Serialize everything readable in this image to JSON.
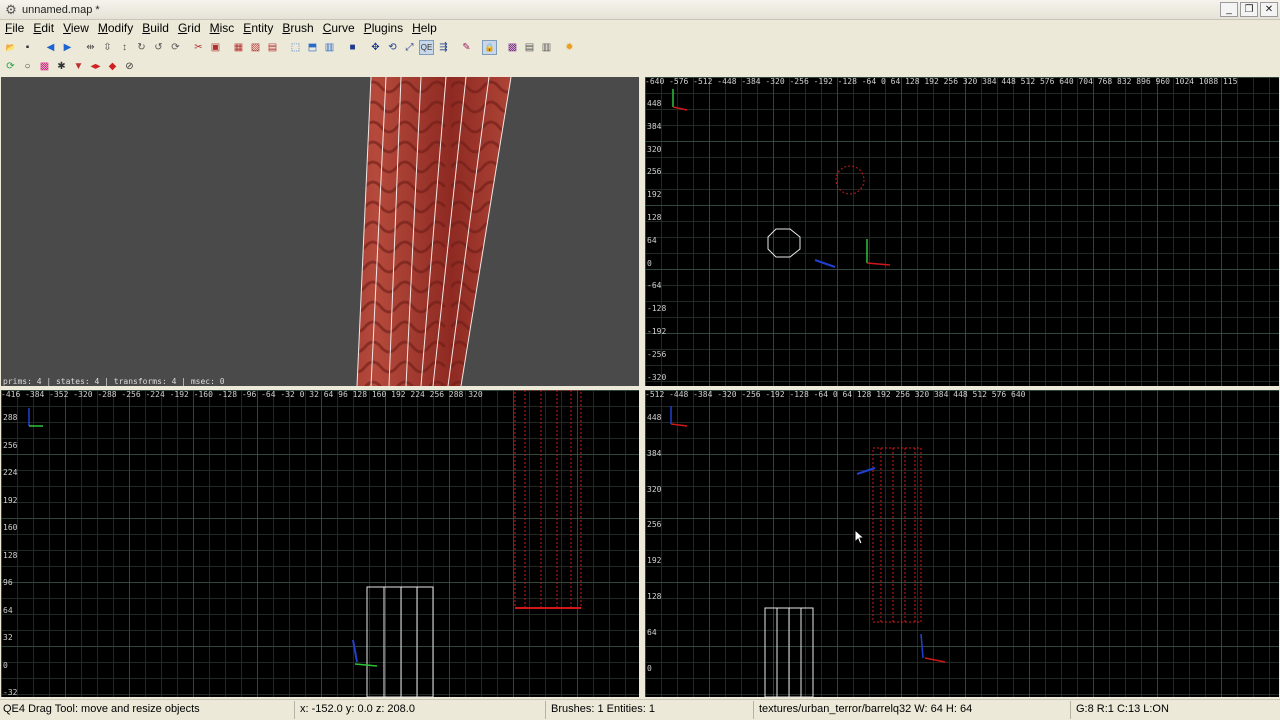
{
  "window": {
    "title": "unnamed.map *",
    "controls": {
      "minimize": "_",
      "restore": "❐",
      "close": "✕"
    }
  },
  "menu": [
    "File",
    "Edit",
    "View",
    "Modify",
    "Build",
    "Grid",
    "Misc",
    "Entity",
    "Brush",
    "Curve",
    "Plugins",
    "Help"
  ],
  "toolbar1_icons": [
    "open-icon",
    "save-icon",
    "sep",
    "undo-icon",
    "redo-icon",
    "sep",
    "flip-x-icon",
    "flip-y-icon",
    "flip-z-icon",
    "rotate-x-icon",
    "rotate-y-icon",
    "rotate-z-icon",
    "sep",
    "clipper-icon",
    "csg-subtract-icon",
    "sep",
    "select-complete-icon",
    "select-touching-icon",
    "select-inside-icon",
    "sep",
    "view-change-icon",
    "view-xy-icon",
    "view-cube-icon",
    "sep",
    "camera-icon",
    "sep",
    "drag-tool-icon",
    "rotate-tool-icon",
    "scale-tool-icon",
    "qe-drag-icon",
    "translate-tool-icon",
    "sep",
    "paint-icon",
    "sep",
    "lock-icon",
    "sep",
    "texture-icon",
    "patch-icon",
    "entity-list-icon",
    "sep",
    "light-icon"
  ],
  "toolbar2_icons": [
    "refresh-icon",
    "sphere-icon",
    "patch-mode-icon",
    "entity-icon",
    "down-icon",
    "mirror-x-icon",
    "mirror-y-icon",
    "no-entry-icon"
  ],
  "camera_view": {
    "stats": "prims: 4 | states: 4 | transforms: 4 | msec: 0"
  },
  "top_view": {
    "x_ruler": "-640 -576 -512 -448 -384 -320 -256 -192 -128 -64  0    64   128  192  256  320  384  448  512  576  640  704  768  832  896  960  1024 1088 115",
    "y_ruler": [
      "448",
      "384",
      "320",
      "256",
      "192",
      "128",
      "64",
      "0",
      "-64",
      "-128",
      "-192",
      "-256",
      "-320"
    ]
  },
  "side_view": {
    "x_ruler": "-416 -384 -352 -320 -288 -256 -224 -192 -160 -128 -96  -64  -32  0    32   64   96   128  160  192  224  256  288  320",
    "y_ruler": [
      "288",
      "256",
      "224",
      "192",
      "160",
      "128",
      "96",
      "64",
      "32",
      "0",
      "-32"
    ]
  },
  "front_view": {
    "x_ruler": "-512 -448 -384 -320 -256 -192 -128 -64   0    64   128  192  256  320  384  448  512  576  640",
    "y_ruler": [
      "448",
      "384",
      "320",
      "256",
      "192",
      "128",
      "64",
      "0",
      "-64"
    ]
  },
  "status": {
    "tool": "QE4 Drag Tool: move and resize objects",
    "coords": "x:  -152.0  y:    0.0  z:   208.0",
    "counts": "Brushes: 1 Entities: 1",
    "texture": "textures/urban_terror/barrelq32 W: 64 H: 64",
    "grid": "G:8  R:1  C:13  L:ON"
  },
  "colors": {
    "brush_red": "#c0392b",
    "selected_dotted": "#d01818",
    "grid_major": "#3c5f4b"
  }
}
